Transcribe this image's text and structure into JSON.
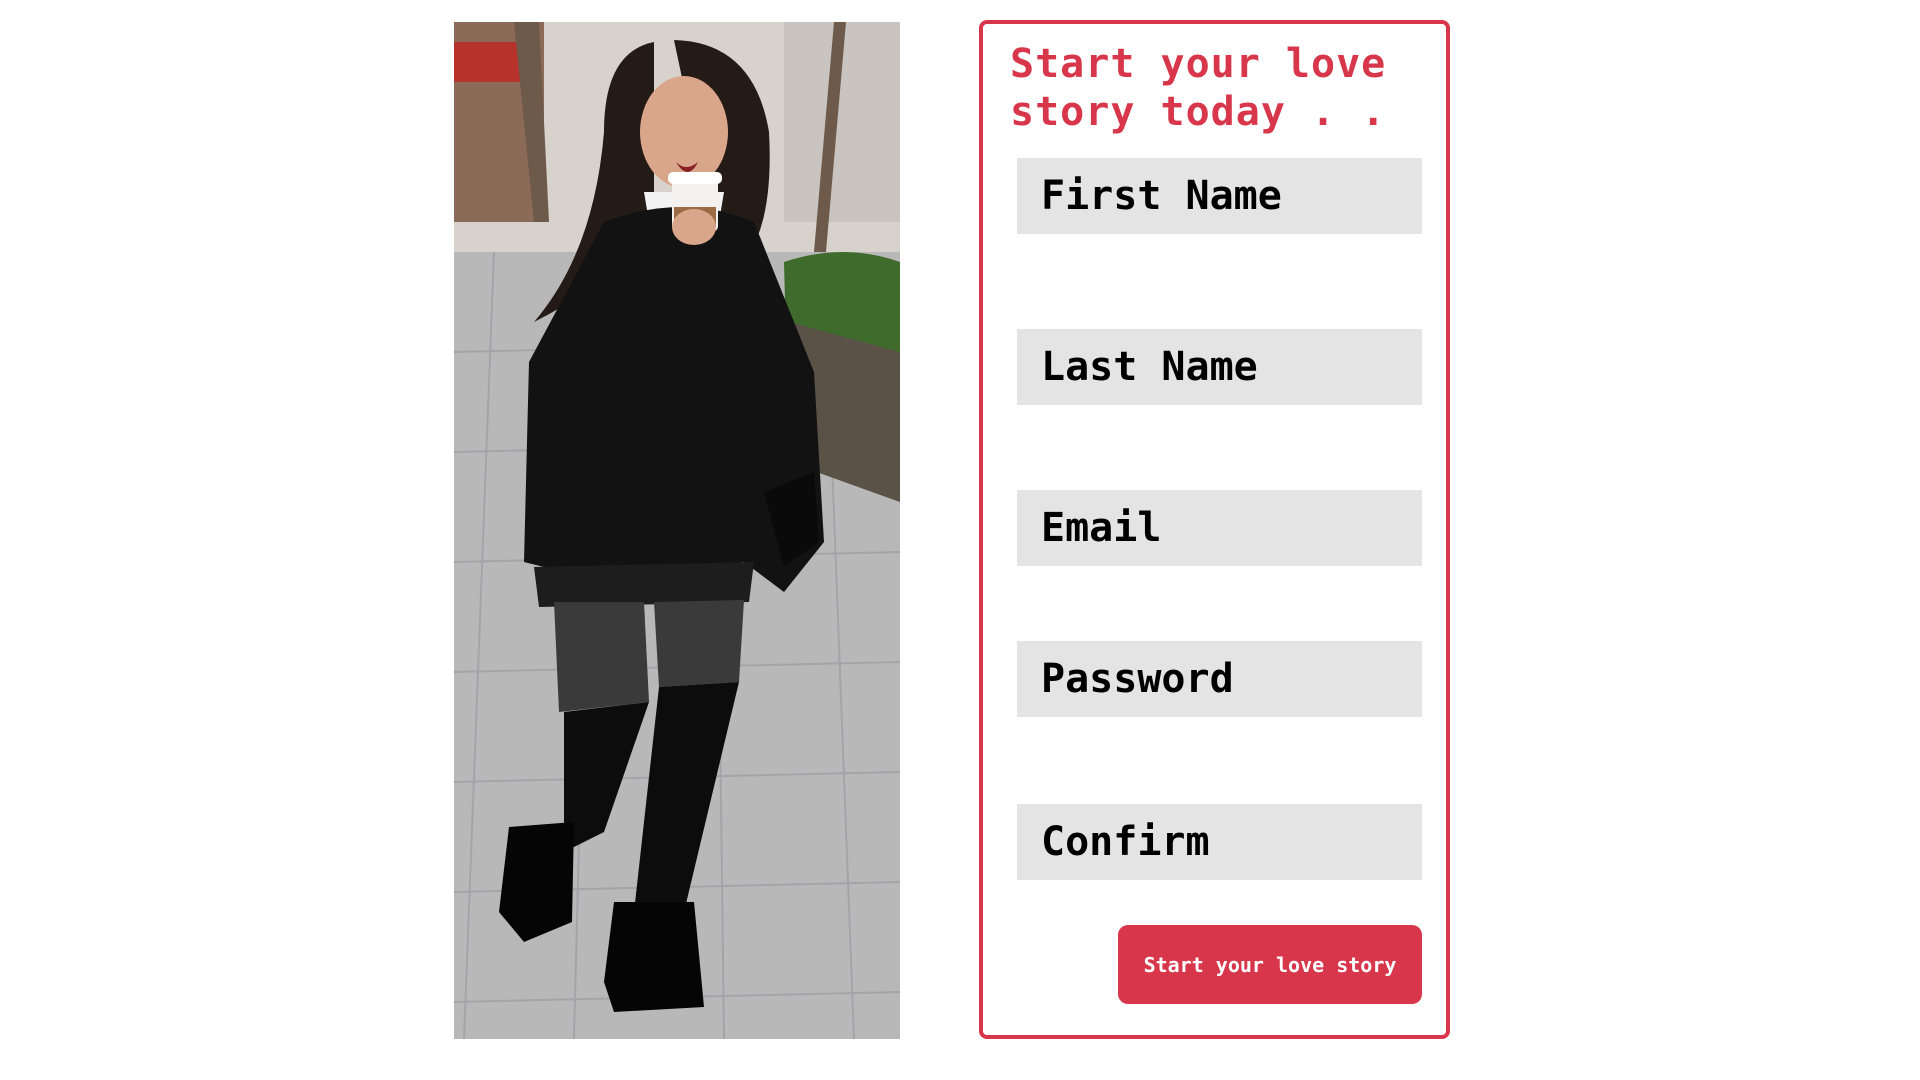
{
  "form": {
    "headline": "Start your love story today . . .",
    "first_name_placeholder": "First Name",
    "last_name_placeholder": "Last Name",
    "email_placeholder": "Email",
    "password_placeholder": "Password",
    "confirm_placeholder": "Confirm",
    "submit_label": "Start your love story"
  },
  "colors": {
    "accent": "#d8374b",
    "field_background": "#e4e4e4",
    "page_background": "#ffffff"
  }
}
